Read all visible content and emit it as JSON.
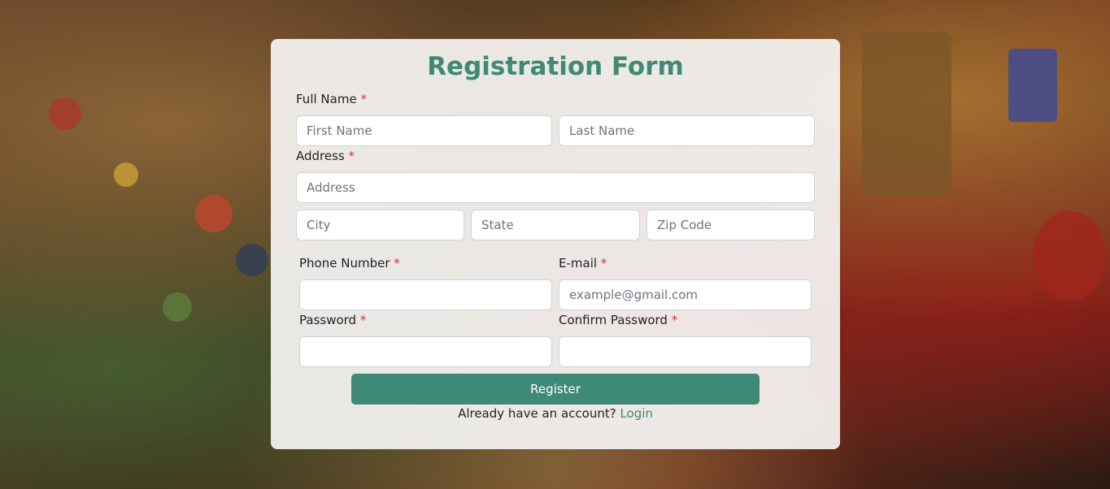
{
  "form": {
    "title": "Registration Form",
    "full_name_label": "Full Name",
    "address_label": "Address",
    "phone_label": "Phone Number",
    "email_label": "E-mail",
    "password_label": "Password",
    "confirm_password_label": "Confirm Password",
    "required_mark": "*",
    "first_name_placeholder": "First Name",
    "last_name_placeholder": "Last Name",
    "address_placeholder": "Address",
    "city_placeholder": "City",
    "state_placeholder": "State",
    "zip_placeholder": "Zip Code",
    "phone_placeholder": "",
    "email_placeholder": "example@gmail.com",
    "password_placeholder": "",
    "confirm_password_placeholder": "",
    "register_label": "Register",
    "footer_text": "Already have an account?",
    "login_label": "Login"
  },
  "colors": {
    "accent": "#3e8a76",
    "required": "#d9343a"
  }
}
